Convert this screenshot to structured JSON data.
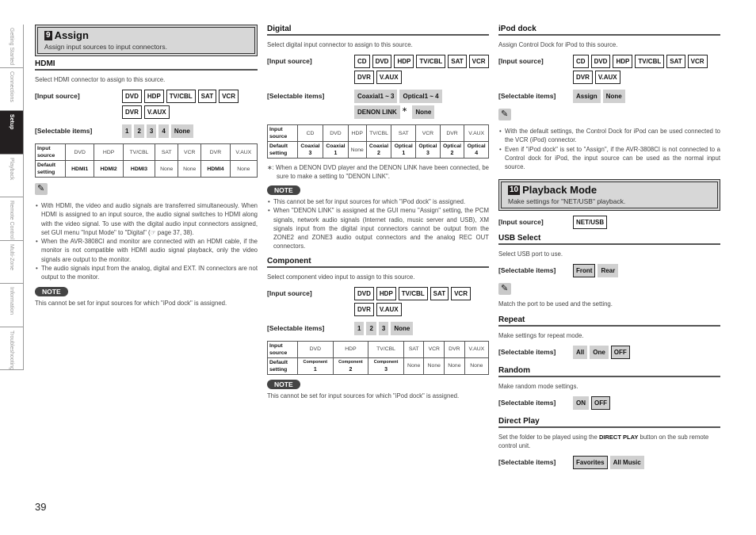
{
  "side_tabs": [
    {
      "label": "Getting Started",
      "active": false
    },
    {
      "label": "Connections",
      "active": false
    },
    {
      "label": "Setup",
      "active": true
    },
    {
      "label": "Playback",
      "active": false
    },
    {
      "label": "Remote Control",
      "active": false
    },
    {
      "label": "Multi-Zone",
      "active": false
    },
    {
      "label": "Information",
      "active": false
    },
    {
      "label": "Troubleshooting",
      "active": false
    }
  ],
  "assign": {
    "number": "9",
    "title": "Assign",
    "subtitle": "Assign input sources to input connectors."
  },
  "hdmi": {
    "heading": "HDMI",
    "description": "Select HDMI connector to assign to this source.",
    "input_label": "[Input source]",
    "inputs": [
      "DVD",
      "HDP",
      "TV/CBL",
      "SAT",
      "VCR",
      "DVR",
      "V.AUX"
    ],
    "selectable_label": "[Selectable items]",
    "selectable": [
      "1",
      "2",
      "3",
      "4",
      "None"
    ],
    "table": {
      "row1_header": "Input source",
      "row2_header": "Default setting",
      "sources": [
        "DVD",
        "HDP",
        "TV/CBL",
        "SAT",
        "VCR",
        "DVR",
        "V.AUX"
      ],
      "defaults": [
        "HDMI1",
        "HDMI2",
        "HDMI3",
        "None",
        "None",
        "HDMI4",
        "None"
      ]
    },
    "tip_icon": "pencil-icon",
    "bullets": [
      "With HDMI, the video and audio signals are transferred simultaneously. When HDMI is assigned to an input source, the audio signal switches to HDMI along with the video signal. To use with the digital audio input connectors assigned, set GUI menu \"Input Mode\" to \"Digital\" (☞ page 37, 38).",
      "When the AVR-3808CI and monitor are connected with an HDMI cable, if the monitor is not compatible with HDMI audio signal playback, only the video signals are output to the monitor.",
      "The audio signals input from the analog, digital and EXT. IN connectors are not output to the monitor."
    ],
    "note_label": "NOTE",
    "note_text": "This cannot be set for input sources for which \"iPod dock\" is assigned."
  },
  "digital": {
    "heading": "Digital",
    "description": "Select digital input connector to assign to this source.",
    "input_label": "[Input source]",
    "inputs": [
      "CD",
      "DVD",
      "HDP",
      "TV/CBL",
      "SAT",
      "VCR",
      "DVR",
      "V.AUX"
    ],
    "selectable_label": "[Selectable items]",
    "selectable": [
      "Coaxial1 ~ 3",
      "Optical1 ~ 4",
      "DENON LINK",
      "None"
    ],
    "asterisk": "∗",
    "table": {
      "row1_header": "Input source",
      "row2_header": "Default setting",
      "sources": [
        "CD",
        "DVD",
        "HDP",
        "TV/CBL",
        "SAT",
        "VCR",
        "DVR",
        "V.AUX"
      ],
      "defaults": [
        {
          "l1": "Coaxial",
          "l2": "3",
          "bold": true
        },
        {
          "l1": "Coaxial",
          "l2": "1",
          "bold": true
        },
        {
          "l1": "None",
          "l2": "",
          "bold": false
        },
        {
          "l1": "Coaxial",
          "l2": "2",
          "bold": true
        },
        {
          "l1": "Optical",
          "l2": "1",
          "bold": true
        },
        {
          "l1": "Optical",
          "l2": "3",
          "bold": true
        },
        {
          "l1": "Optical",
          "l2": "2",
          "bold": true
        },
        {
          "l1": "Optical",
          "l2": "4",
          "bold": true
        }
      ]
    },
    "footnote": "∗: When a DENON DVD player and the DENON LINK have been connected, be sure to make a setting to \"DENON LINK\".",
    "note_label": "NOTE",
    "bullets": [
      "This cannot be set for input sources for which \"iPod dock\" is assigned.",
      "When \"DENON LINK\" is assigned at the GUI menu \"Assign\" setting, the PCM signals, network audio signals (Internet radio, music server and USB), XM signals input from the digital input connectors cannot be output from the ZONE2 and ZONE3 audio output connectors and the analog REC OUT connectors."
    ]
  },
  "component": {
    "heading": "Component",
    "description": "Select component video input to assign to this source.",
    "input_label": "[Input source]",
    "inputs": [
      "DVD",
      "HDP",
      "TV/CBL",
      "SAT",
      "VCR",
      "DVR",
      "V.AUX"
    ],
    "selectable_label": "[Selectable items]",
    "selectable": [
      "1",
      "2",
      "3",
      "None"
    ],
    "table": {
      "row1_header": "Input source",
      "row2_header": "Default setting",
      "sources": [
        "DVD",
        "HDP",
        "TV/CBL",
        "SAT",
        "VCR",
        "DVR",
        "V.AUX"
      ],
      "defaults": [
        {
          "l1": "Component",
          "l2": "1",
          "bold": true
        },
        {
          "l1": "Component",
          "l2": "2",
          "bold": true
        },
        {
          "l1": "Component",
          "l2": "3",
          "bold": true
        },
        {
          "l1": "None",
          "l2": "",
          "bold": false
        },
        {
          "l1": "None",
          "l2": "",
          "bold": false
        },
        {
          "l1": "None",
          "l2": "",
          "bold": false
        },
        {
          "l1": "None",
          "l2": "",
          "bold": false
        }
      ]
    },
    "note_label": "NOTE",
    "note_text": "This cannot be set for input sources for which \"iPod dock\" is assigned."
  },
  "ipod": {
    "heading": "iPod dock",
    "description": "Assign Control Dock for iPod to this source.",
    "input_label": "[Input source]",
    "inputs": [
      "CD",
      "DVD",
      "HDP",
      "TV/CBL",
      "SAT",
      "VCR",
      "DVR",
      "V.AUX"
    ],
    "selectable_label": "[Selectable items]",
    "selectable": [
      "Assign",
      "None"
    ],
    "bullets": [
      "With the default settings, the Control Dock for iPod can be used connected to the VCR (iPod) connector.",
      "Even if \"iPod dock\" is set to \"Assign\", if the AVR-3808CI is not connected to a Control dock for iPod, the input source can be used as the normal input source."
    ]
  },
  "playback": {
    "number": "10",
    "title": "Playback Mode",
    "subtitle": "Make settings for \"NET/USB\" playback.",
    "input_label": "[Input source]",
    "input": "NET/USB"
  },
  "usb_select": {
    "heading": "USB Select",
    "description": "Select USB port to use.",
    "selectable_label": "[Selectable items]",
    "selectable": [
      "Front",
      "Rear"
    ],
    "default_index": 0,
    "tip": "Match the port to be used and the setting."
  },
  "repeat": {
    "heading": "Repeat",
    "description": "Make settings for repeat mode.",
    "selectable_label": "[Selectable items]",
    "selectable": [
      "All",
      "One",
      "OFF"
    ],
    "default_index": 2
  },
  "random": {
    "heading": "Random",
    "description": "Make random mode settings.",
    "selectable_label": "[Selectable items]",
    "selectable": [
      "ON",
      "OFF"
    ],
    "default_index": 1
  },
  "direct_play": {
    "heading": "Direct Play",
    "description_pre": "Set the folder to be played using the ",
    "description_bold": "DIRECT PLAY",
    "description_post": " button on the sub remote control unit.",
    "selectable_label": "[Selectable items]",
    "selectable": [
      "Favorites",
      "All Music"
    ],
    "default_index": 0
  },
  "page_number": "39"
}
